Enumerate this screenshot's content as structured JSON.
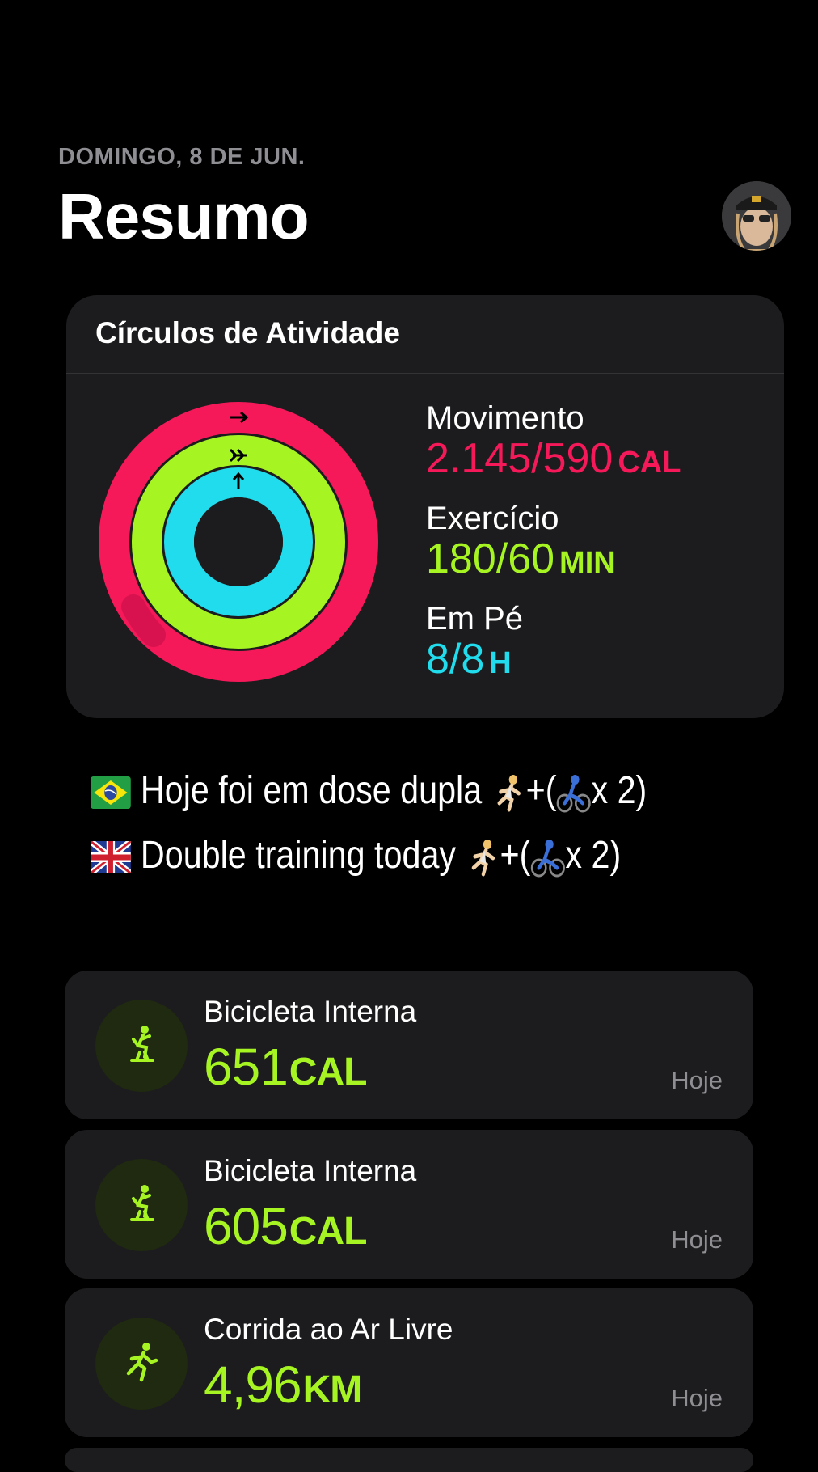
{
  "header": {
    "date": "DOMINGO, 8 DE JUN.",
    "title": "Resumo"
  },
  "activity": {
    "title": "Círculos de Atividade",
    "move": {
      "label": "Movimento",
      "value": "2.145/590",
      "unit": "CAL",
      "current": 2145,
      "goal": 590,
      "color": "#f5195a"
    },
    "exercise": {
      "label": "Exercício",
      "value": "180/60",
      "unit": "MIN",
      "current": 180,
      "goal": 60,
      "color": "#a6f522"
    },
    "stand": {
      "label": "Em Pé",
      "value": "8/8",
      "unit": "H",
      "current": 8,
      "goal": 8,
      "color": "#20dcec"
    }
  },
  "caption": {
    "line1": "Hoje foi em dose dupla",
    "line1_tail": "+(",
    "line1_end": "x 2)",
    "line2": "Double training today",
    "line2_tail": "+(",
    "line2_end": "x 2)",
    "icons": [
      "brazil-flag",
      "uk-flag",
      "runner-emoji",
      "cyclist-emoji"
    ]
  },
  "workouts": [
    {
      "name": "Bicicleta Interna",
      "value": "651",
      "unit": "CAL",
      "when": "Hoje",
      "icon": "indoor-cycle-icon"
    },
    {
      "name": "Bicicleta Interna",
      "value": "605",
      "unit": "CAL",
      "when": "Hoje",
      "icon": "indoor-cycle-icon"
    },
    {
      "name": "Corrida ao Ar Livre",
      "value": "4,96",
      "unit": "KM",
      "when": "Hoje",
      "icon": "outdoor-run-icon"
    }
  ],
  "colors": {
    "background": "#000000",
    "card": "#1c1c1e",
    "secondary_text": "#8e8e93"
  }
}
